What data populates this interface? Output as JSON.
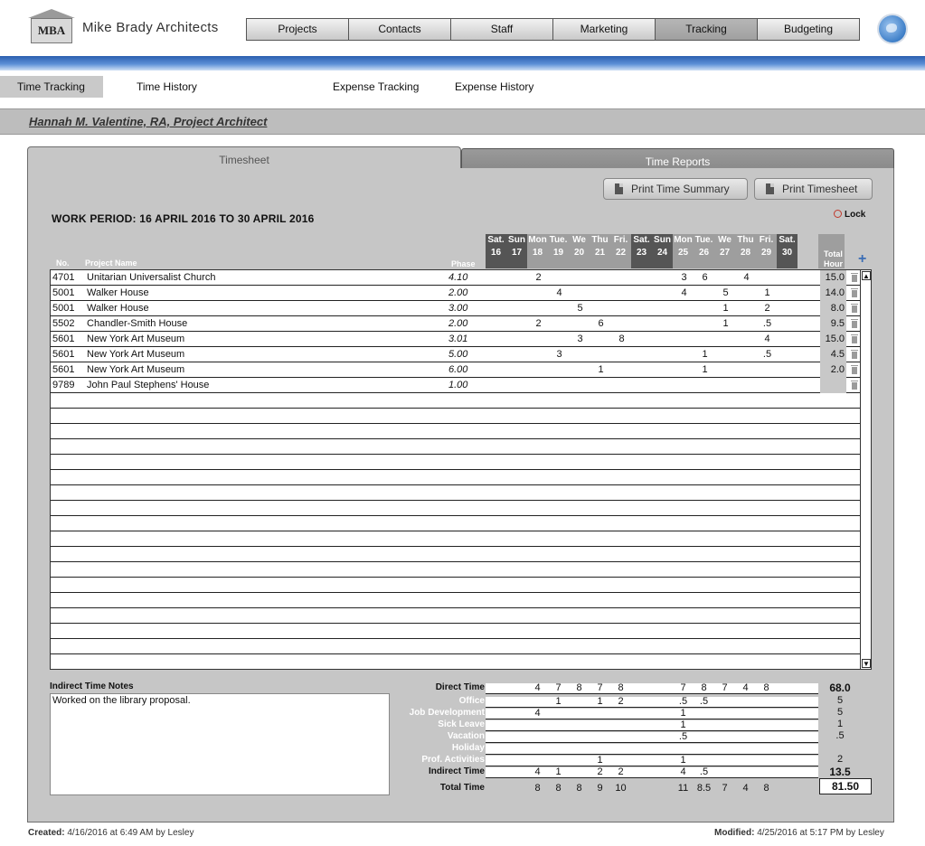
{
  "app": {
    "logo_text": "MBA",
    "company": "Mike Brady Architects"
  },
  "nav": [
    "Projects",
    "Contacts",
    "Staff",
    "Marketing",
    "Tracking",
    "Budgeting"
  ],
  "subnav": [
    "Time Tracking",
    "Time History",
    "Expense Tracking",
    "Expense History"
  ],
  "person": "Hannah M. Valentine, RA, Project Architect",
  "tabs": {
    "timesheet": "Timesheet",
    "reports": "Time Reports"
  },
  "buttons": {
    "print_summary": "Print Time Summary",
    "print_timesheet": "Print Timesheet"
  },
  "work_period": "WORK PERIOD:  16 APRIL 2016  TO 30 APRIL 2016",
  "lock_label": "Lock",
  "headers": {
    "no": "No.",
    "project": "Project Name",
    "phase": "Phase",
    "total1": "Total",
    "total2": "Hour"
  },
  "days": [
    {
      "n": "Sat.",
      "d": "16",
      "weekend": true
    },
    {
      "n": "Sun",
      "d": "17",
      "weekend": true
    },
    {
      "n": "Mon",
      "d": "18"
    },
    {
      "n": "Tue.",
      "d": "19"
    },
    {
      "n": "We",
      "d": "20"
    },
    {
      "n": "Thu",
      "d": "21"
    },
    {
      "n": "Fri.",
      "d": "22"
    },
    {
      "n": "Sat.",
      "d": "23",
      "weekend": true
    },
    {
      "n": "Sun",
      "d": "24",
      "weekend": true
    },
    {
      "n": "Mon",
      "d": "25"
    },
    {
      "n": "Tue.",
      "d": "26"
    },
    {
      "n": "We",
      "d": "27"
    },
    {
      "n": "Thu",
      "d": "28"
    },
    {
      "n": "Fri.",
      "d": "29"
    },
    {
      "n": "Sat.",
      "d": "30",
      "weekend": true
    }
  ],
  "rows": [
    {
      "no": "4701",
      "name": "Unitarian Universalist Church",
      "phase": "4.10",
      "hours": [
        "",
        "",
        "2",
        "",
        "",
        "",
        "",
        "",
        "",
        "3",
        "6",
        "",
        "4",
        "",
        ""
      ],
      "total": "15.0"
    },
    {
      "no": "5001",
      "name": "Walker House",
      "phase": "2.00",
      "hours": [
        "",
        "",
        "",
        "4",
        "",
        "",
        "",
        "",
        "",
        "4",
        "",
        "5",
        "",
        "1",
        ""
      ],
      "total": "14.0"
    },
    {
      "no": "5001",
      "name": "Walker House",
      "phase": "3.00",
      "hours": [
        "",
        "",
        "",
        "",
        "5",
        "",
        "",
        "",
        "",
        "",
        "",
        "1",
        "",
        "2",
        ""
      ],
      "total": "8.0"
    },
    {
      "no": "5502",
      "name": "Chandler-Smith House",
      "phase": "2.00",
      "hours": [
        "",
        "",
        "2",
        "",
        "",
        "6",
        "",
        "",
        "",
        "",
        "",
        "1",
        "",
        ".5",
        ""
      ],
      "total": "9.5"
    },
    {
      "no": "5601",
      "name": "New York Art Museum",
      "phase": "3.01",
      "hours": [
        "",
        "",
        "",
        "",
        "3",
        "",
        "8",
        "",
        "",
        "",
        "",
        "",
        "",
        "4",
        ""
      ],
      "total": "15.0"
    },
    {
      "no": "5601",
      "name": "New York Art Museum",
      "phase": "5.00",
      "hours": [
        "",
        "",
        "",
        "3",
        "",
        "",
        "",
        "",
        "",
        "",
        "1",
        "",
        "",
        ".5",
        ""
      ],
      "total": "4.5"
    },
    {
      "no": "5601",
      "name": "New York Art Museum",
      "phase": "6.00",
      "hours": [
        "",
        "",
        "",
        "",
        "",
        "1",
        "",
        "",
        "",
        "",
        "1",
        "",
        "",
        "",
        ""
      ],
      "total": "2.0"
    },
    {
      "no": "9789",
      "name": "John Paul Stephens' House",
      "phase": "1.00",
      "hours": [
        "",
        "",
        "",
        "",
        "",
        "",
        "",
        "",
        "",
        "",
        "",
        "",
        "",
        "",
        ""
      ],
      "total": ""
    }
  ],
  "notes": {
    "title": "Indirect Time Notes",
    "text": "Worked on the library proposal."
  },
  "summary": [
    {
      "label": "Direct Time",
      "values": [
        "",
        "",
        "4",
        "7",
        "8",
        "7",
        "8",
        "",
        "",
        "7",
        "8",
        "7",
        "4",
        "8",
        ""
      ],
      "total": "68.0",
      "bold_total": true,
      "white": false
    },
    {
      "label": "Office",
      "values": [
        "",
        "",
        "",
        "1",
        "",
        "1",
        "2",
        "",
        "",
        ".5",
        ".5",
        "",
        "",
        "",
        ""
      ],
      "total": "5",
      "white": true
    },
    {
      "label": "Job Development",
      "values": [
        "",
        "",
        "4",
        "",
        "",
        "",
        "",
        "",
        "",
        "1",
        "",
        "",
        "",
        "",
        ""
      ],
      "total": "5",
      "white": true
    },
    {
      "label": "Sick Leave",
      "values": [
        "",
        "",
        "",
        "",
        "",
        "",
        "",
        "",
        "",
        "1",
        "",
        "",
        "",
        "",
        ""
      ],
      "total": "1",
      "white": true
    },
    {
      "label": "Vacation",
      "values": [
        "",
        "",
        "",
        "",
        "",
        "",
        "",
        "",
        "",
        ".5",
        "",
        "",
        "",
        "",
        ""
      ],
      "total": ".5",
      "white": true
    },
    {
      "label": "Holiday",
      "values": [
        "",
        "",
        "",
        "",
        "",
        "",
        "",
        "",
        "",
        "",
        "",
        "",
        "",
        "",
        ""
      ],
      "total": "",
      "white": true
    },
    {
      "label": "Prof. Activities",
      "values": [
        "",
        "",
        "",
        "",
        "",
        "1",
        "",
        "",
        "",
        "1",
        "",
        "",
        "",
        "",
        ""
      ],
      "total": "2",
      "white": true
    },
    {
      "label": "Indirect Time",
      "values": [
        "",
        "",
        "4",
        "1",
        "",
        "2",
        "2",
        "",
        "",
        "4",
        ".5",
        "",
        "",
        "",
        ""
      ],
      "total": "13.5",
      "bold_total": true,
      "white": false
    },
    {
      "label": "Total Time",
      "values": [
        "",
        "",
        "8",
        "8",
        "8",
        "9",
        "10",
        "",
        "",
        "11",
        "8.5",
        "7",
        "4",
        "8",
        ""
      ],
      "total": "81.50",
      "white": false
    }
  ],
  "footer": {
    "created_label": "Created:",
    "created": "4/16/2016 at 6:49 AM by Lesley",
    "modified_label": "Modified:",
    "modified": "4/25/2016 at 5:17 PM by Lesley"
  },
  "colors": {
    "accent_blue": "#3e7fc8",
    "weekend_header": "#555555",
    "weekday_header": "#9e9e9e",
    "panel": "#c6c6c6"
  }
}
